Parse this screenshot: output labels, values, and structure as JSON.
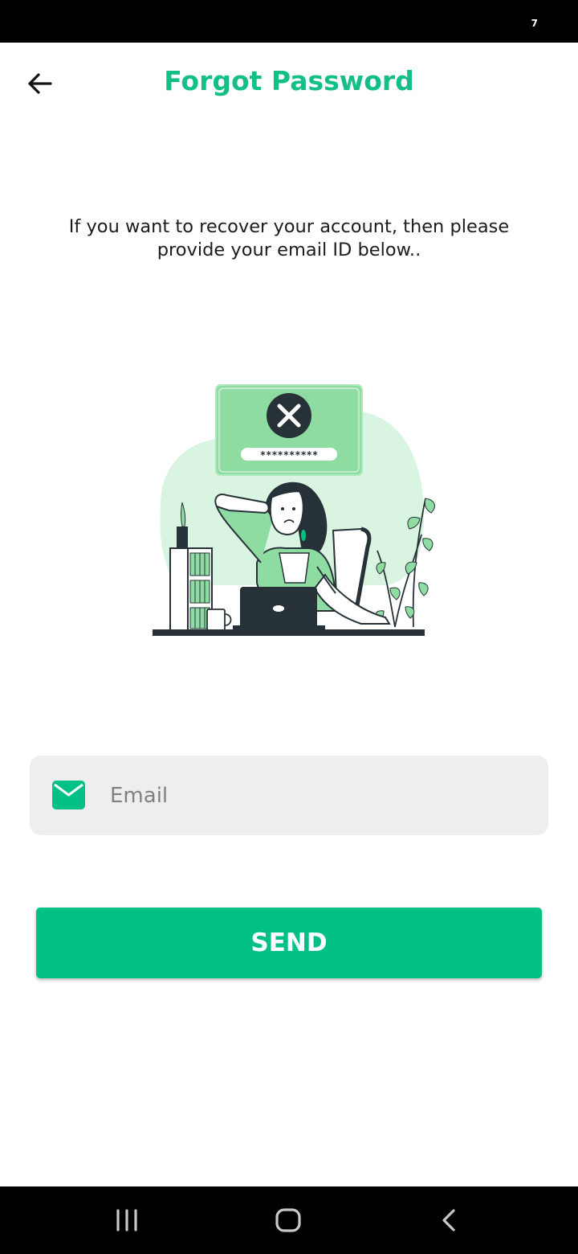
{
  "status_bar": {
    "indicator": "7"
  },
  "header": {
    "title": "Forgot Password",
    "back_icon": "arrow-left-icon"
  },
  "instruction": {
    "text": "If you want to recover your account, then please provide your email ID below.."
  },
  "illustration": {
    "password_mask": "**********"
  },
  "email_field": {
    "placeholder": "Email",
    "value": "",
    "icon": "mail-icon"
  },
  "send_button": {
    "label": "SEND"
  },
  "colors": {
    "brand": "#03c087",
    "title": "#13bf87",
    "field_bg": "#eeeeee",
    "illustration_green": "#8fdca3",
    "illustration_dark": "#263238"
  },
  "nav_bar": {
    "recent_icon": "recent-apps-icon",
    "home_icon": "home-icon",
    "back_icon": "nav-back-icon"
  }
}
